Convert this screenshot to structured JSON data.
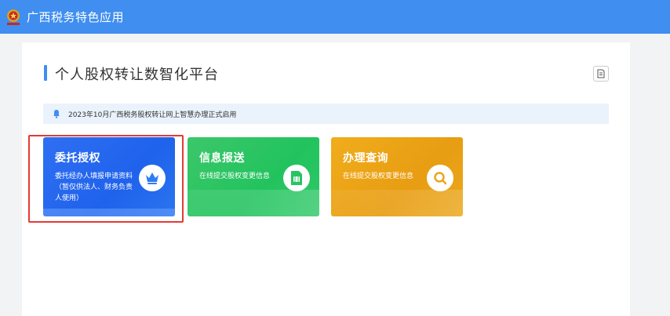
{
  "topbar": {
    "title": "广西税务特色应用",
    "logo_icon": "tax-emblem-icon",
    "background": "#3f8ef0"
  },
  "page": {
    "title": "个人股权转让数智化平台",
    "doc_button_icon": "document-icon"
  },
  "notice": {
    "icon": "bell-icon",
    "text": "2023年10月广西税务股权转让网上智慧办理正式启用"
  },
  "cards": [
    {
      "title": "委托授权",
      "desc": "委托经办人填报申请资料（暂仅供法人、财务负责人使用）",
      "icon": "crown-icon",
      "color": "#2468ee",
      "selected": true
    },
    {
      "title": "信息报送",
      "desc": "在线提交股权变更信息",
      "icon": "sim-card-icon",
      "color": "#27c463"
    },
    {
      "title": "办理查询",
      "desc": "在线提交股权变更信息",
      "icon": "search-icon",
      "color": "#eca51a"
    }
  ]
}
